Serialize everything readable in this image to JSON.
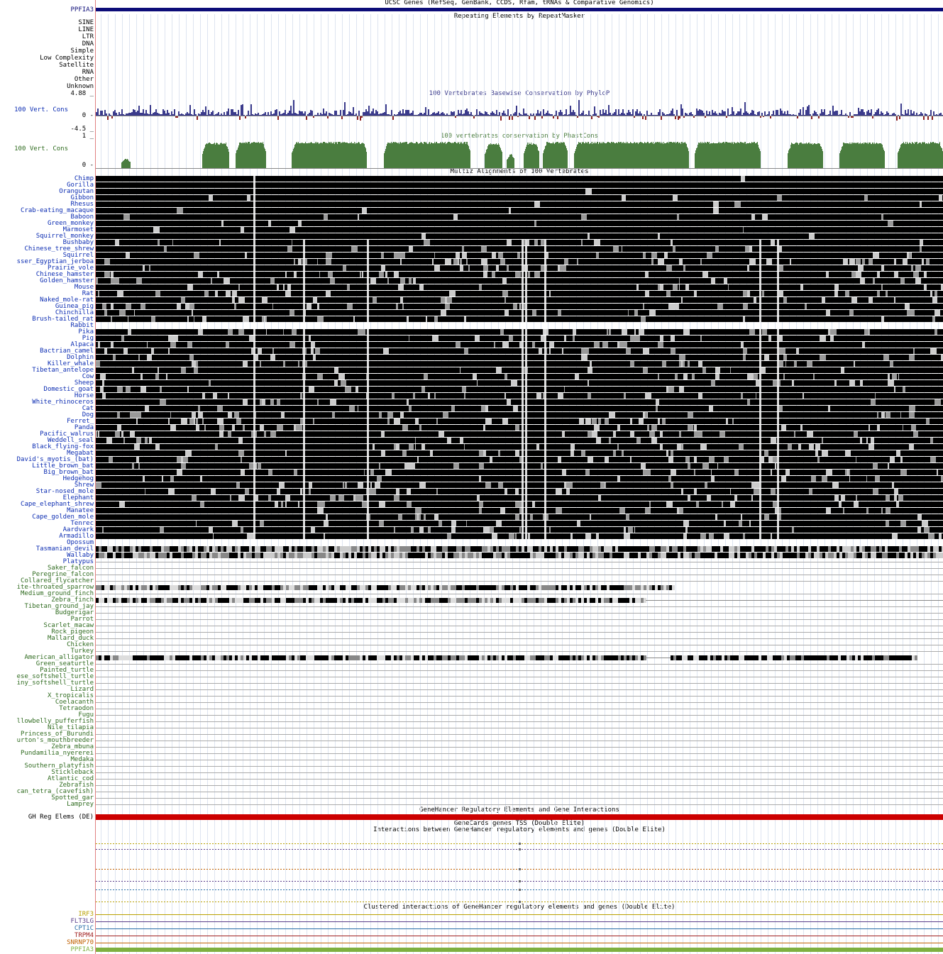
{
  "colors": {
    "gene_blue": "#0c0c78",
    "phylop_pos": "#3b3b8c",
    "phylop_neg": "#8c2020",
    "phastcons": "#4a7d3f",
    "mammal_label": "#0b2cb2",
    "other_label": "#2f6b1f",
    "genehancer_red": "#cc0000",
    "ppfia3_green": "#7fb040"
  },
  "tracks": {
    "ucsc_genes": {
      "title": "UCSC Genes (RefSeq, GenBank, CCDS, Rfam, tRNAs & Comparative Genomics)",
      "label": "PPFIA3"
    },
    "repeatmasker": {
      "title": "Repeating Elements by RepeatMasker",
      "classes": [
        "SINE",
        "LINE",
        "LTR",
        "DNA",
        "Simple",
        "Low Complexity",
        "Satellite",
        "RNA",
        "Other",
        "Unknown"
      ]
    },
    "phylop": {
      "title": "100 Vertebrates Basewise Conservation by PhyloP",
      "label": "100 Vert. Cons",
      "max_label": "4.88 _",
      "zero_label": "0 -",
      "min_label": "-4.5 _"
    },
    "phastcons": {
      "title": "100 vertebrates conservation by PhastCons",
      "label": "100 Vert. Cons",
      "max_label": "1 _",
      "zero_label": "0 -"
    },
    "multiz": {
      "title": "Multiz Alignments of 100 Vertebrates",
      "species": [
        "Chimp",
        "Gorilla",
        "Orangutan",
        "Gibbon",
        "Rhesus",
        "Crab-eating_macaque",
        "Baboon",
        "Green_monkey",
        "Marmoset",
        "Squirrel_monkey",
        "Bushbaby",
        "Chinese_tree_shrew",
        "Squirrel",
        "sser_Egyptian_jerboa",
        "Prairie_vole",
        "Chinese_hamster",
        "Golden_hamster",
        "Mouse",
        "Rat",
        "Naked_mole-rat",
        "Guinea_pig",
        "Chinchilla",
        "Brush-tailed_rat",
        "Rabbit",
        "Pika",
        "Pig",
        "Alpaca",
        "Bactrian_camel",
        "Dolphin",
        "Killer_whale",
        "Tibetan_antelope",
        "Cow",
        "Sheep",
        "Domestic_goat",
        "Horse",
        "White_rhinoceros",
        "Cat",
        "Dog",
        "Ferret_",
        "Panda",
        "Pacific_walrus",
        "Weddell_seal",
        "Black_flying-fox",
        "Megabat",
        "David's_myotis_(bat)",
        "Little_brown_bat",
        "Big_brown_bat",
        "Hedgehog",
        "Shrew",
        "Star-nosed_mole",
        "Elephant",
        "Cape_elephant_shrew",
        "Manatee",
        "Cape_golden_mole",
        "Tenrec",
        "Aardvark",
        "Armadillo",
        "Opossum",
        "Tasmanian_devil",
        "Wallaby",
        "Platypus",
        "Saker_falcon",
        "Peregrine_falcon",
        "Collared_flycatcher",
        "ite-throated_sparrow",
        "Medium_ground_finch",
        "Zebra_finch",
        "Tibetan_ground_jay",
        "Budgerigar",
        "Parrot",
        "Scarlet_macaw",
        "Rock_pigeon",
        "Mallard_duck",
        "Chicken",
        "Turkey",
        "American_alligator",
        "Green_seaturtle",
        "Painted_turtle",
        "ese_softshell_turtle",
        "iny_softshell_turtle",
        "Lizard",
        "X_tropicalis",
        "Coelacanth",
        "Tetraodon",
        "Fugu",
        "llowbelly_pufferfish",
        "Nile_tilapia",
        "Princess_of_Burundi",
        "urton's_mouthbreeder",
        "Zebra_mbuna",
        "Pundamilia_nyererei",
        "Medaka",
        "Southern_platyfish",
        "Stickleback",
        "Atlantic_cod",
        "Zebrafish",
        "can_tetra_(cavefish)",
        "Spotted_gar",
        "Lamprey"
      ]
    },
    "genehancer": {
      "title": "GeneHancer Regulatory Elements and Gene Interactions",
      "label": "GH Reg Elems (DE)"
    },
    "genecards_tss": {
      "title": "GeneCards genes TSS (Double Elite)"
    },
    "interactions": {
      "title": "Interactions between GeneHancer regulatory elements and genes (Double Elite)"
    },
    "clustered": {
      "title": "Clustered interactions of GeneHancer regulatory elements and genes (Double Elite)",
      "genes": [
        {
          "name": "IRF3",
          "color": "#b8a000"
        },
        {
          "name": "FLT3LG",
          "color": "#5a3e8a"
        },
        {
          "name": "CPT1C",
          "color": "#2a6fa8"
        },
        {
          "name": "TRPM4",
          "color": "#a02020"
        },
        {
          "name": "SNRNP70",
          "color": "#c06000"
        },
        {
          "name": "PPFIA3",
          "color": "#7fb040"
        }
      ]
    }
  }
}
